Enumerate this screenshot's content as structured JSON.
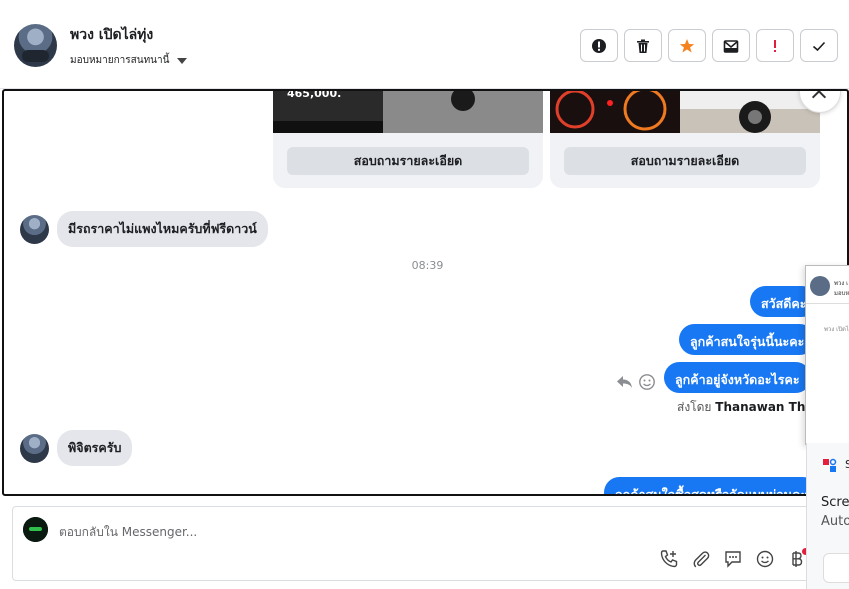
{
  "header": {
    "contact_name": "พวง เปิดไล่ทุ่ง",
    "assign_label": "มอบหมายการสนทนานี้",
    "toolbar": [
      {
        "name": "report-spam-button",
        "icon": "alert-circle-icon"
      },
      {
        "name": "delete-button",
        "icon": "trash-icon"
      },
      {
        "name": "star-button",
        "icon": "star-icon"
      },
      {
        "name": "mark-unread-button",
        "icon": "envelope-icon"
      },
      {
        "name": "follow-up-button",
        "icon": "exclamation-icon"
      },
      {
        "name": "mark-done-button",
        "icon": "check-icon"
      }
    ]
  },
  "cards": [
    {
      "button_label": "สอบถามรายละเอียด",
      "image_text": "465,000."
    },
    {
      "button_label": "สอบถามรายละเอียด"
    }
  ],
  "messages": {
    "incoming_1": "มีรถราคาไม่แพงไหมครับที่ฟรีดาวน์",
    "timestamp": "08:39",
    "outgoing_1": "สวัสดีคะ",
    "outgoing_2": "ลูกค้าสนใจรุ่นนี้นะคะ",
    "outgoing_3": "ลูกค้าอยู่จังหวัดอะไรคะ",
    "sent_by_prefix": "ส่งโดย",
    "sent_by_name": "Thanawan Thon",
    "incoming_2": "พิจิตรครับ",
    "outgoing_4": "ลูกค้าสนใจซื้อสดหรือจัดแบบผ่อนคะ"
  },
  "floating_panel": {
    "line1": "พวง เ",
    "line2": "มอบหม",
    "line3": "พวง เปิดไล่ทุ่ง"
  },
  "snippet": {
    "app_label": "S",
    "line1": "Screen",
    "line2": "Auto"
  },
  "composer": {
    "placeholder": "ตอบกลับใน Messenger..."
  },
  "colors": {
    "accent": "#1877f2",
    "star": "#f5821f",
    "alert": "#e41e3f"
  }
}
